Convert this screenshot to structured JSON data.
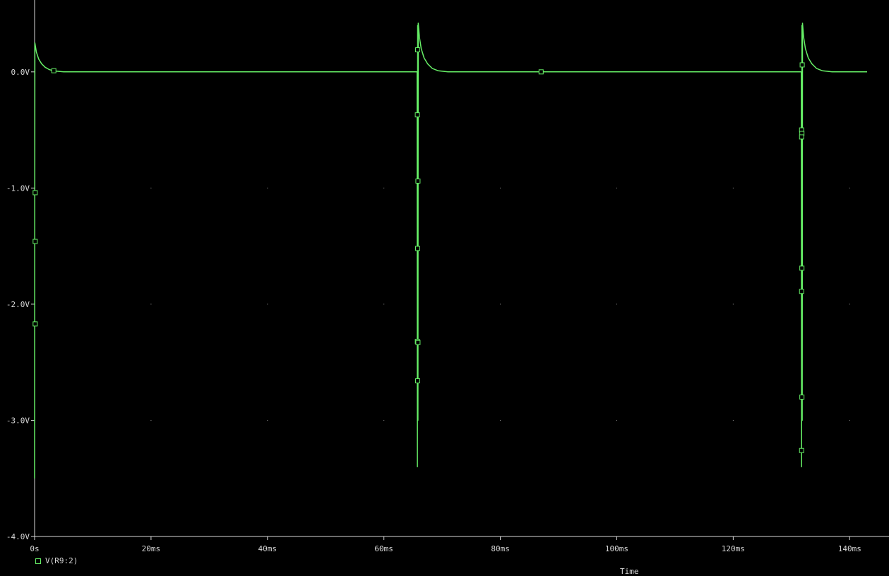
{
  "chart_data": {
    "type": "line",
    "xlabel": "Time",
    "xlim": [
      0,
      143
    ],
    "ylim": [
      -4.0,
      0.4
    ],
    "x_ticks": [
      0,
      20,
      40,
      60,
      80,
      100,
      120,
      140
    ],
    "x_tick_labels": [
      "0s",
      "20ms",
      "40ms",
      "60ms",
      "80ms",
      "100ms",
      "120ms",
      "140ms"
    ],
    "y_ticks": [
      0.0,
      -1.0,
      -2.0,
      -3.0,
      -4.0
    ],
    "y_tick_labels": [
      "0.0V",
      "-1.0V",
      "-2.0V",
      "-3.0V",
      "-4.0V"
    ],
    "grid": "dotted",
    "series": [
      {
        "name": "V(R9:2)",
        "color": "#66ee66",
        "x": [
          0,
          0.05,
          0.3,
          0.7,
          1.2,
          1.8,
          2.5,
          3.3,
          5,
          65.7,
          65.75,
          65.8,
          65.85,
          65.9,
          66.1,
          66.4,
          66.9,
          67.5,
          68.3,
          69.3,
          71,
          131.7,
          131.75,
          131.8,
          131.85,
          131.9,
          132.1,
          132.4,
          132.9,
          133.5,
          134.3,
          135.3,
          137,
          143
        ],
        "values": [
          -3.5,
          0.25,
          0.17,
          0.11,
          0.07,
          0.04,
          0.02,
          0.008,
          0.0,
          0.0,
          -3.4,
          0.4,
          -3.0,
          0.42,
          0.3,
          0.2,
          0.12,
          0.07,
          0.03,
          0.01,
          0.0,
          0.0,
          -3.4,
          0.4,
          -3.0,
          0.42,
          0.3,
          0.2,
          0.12,
          0.07,
          0.03,
          0.01,
          0.0,
          0.0
        ]
      }
    ],
    "markers": {
      "x": [
        3.3,
        0.1,
        0.1,
        0.1,
        65.8,
        65.75,
        65.85,
        65.8,
        65.75,
        65.85,
        65.8,
        87,
        131.85,
        131.75,
        131.8,
        131.75,
        131.8,
        131.75,
        131.8,
        131.75
      ],
      "values": [
        0.01,
        -1.04,
        -1.46,
        -2.17,
        0.19,
        -0.37,
        -0.94,
        -1.52,
        -2.32,
        -2.33,
        -2.66,
        0.0,
        0.06,
        -0.5,
        -0.53,
        -0.56,
        -1.69,
        -1.89,
        -2.8,
        -3.26
      ]
    },
    "legend": "bottom-left"
  }
}
